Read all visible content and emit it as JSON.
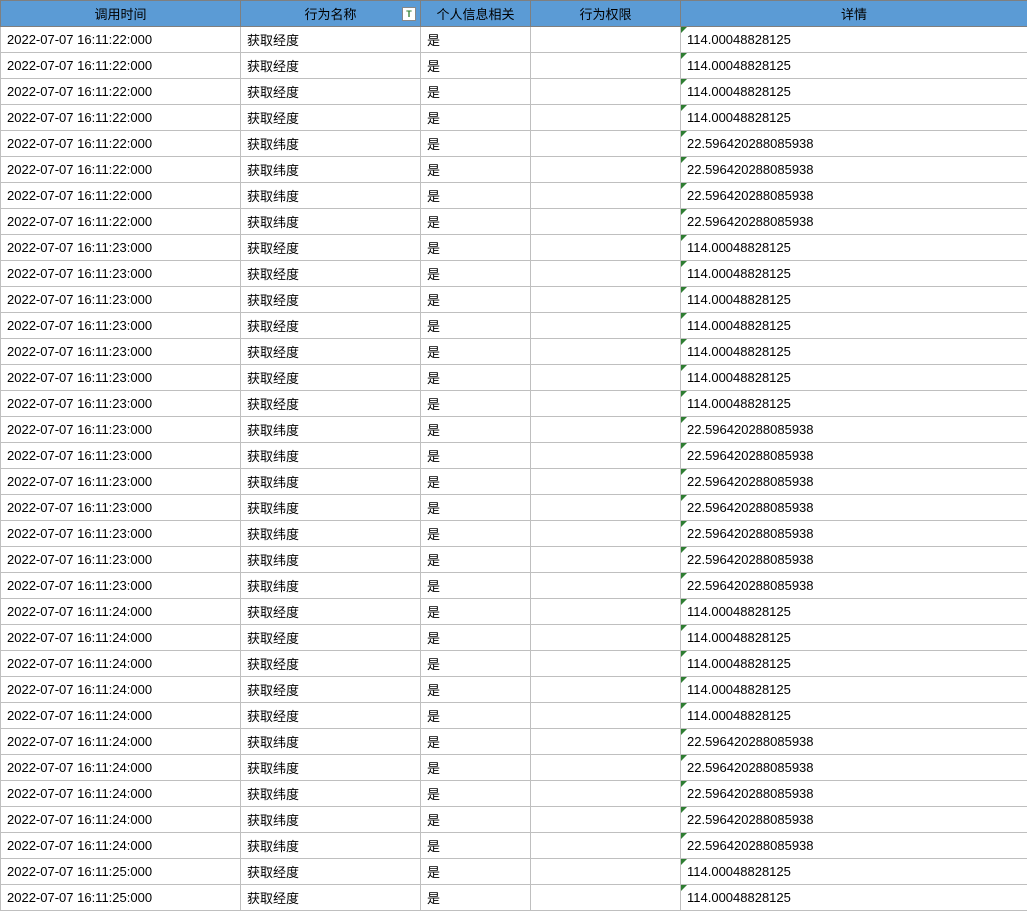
{
  "columns": [
    {
      "label": "调用时间",
      "filter": false
    },
    {
      "label": "行为名称",
      "filter": true
    },
    {
      "label": "个人信息相关",
      "filter": false
    },
    {
      "label": "行为权限",
      "filter": false
    },
    {
      "label": "详情",
      "filter": false
    }
  ],
  "filter_icon_text": "T",
  "rows": [
    {
      "time": "2022-07-07 16:11:22:000",
      "action": "获取经度",
      "personal": "是",
      "perm": "",
      "detail": "114.00048828125"
    },
    {
      "time": "2022-07-07 16:11:22:000",
      "action": "获取经度",
      "personal": "是",
      "perm": "",
      "detail": "114.00048828125"
    },
    {
      "time": "2022-07-07 16:11:22:000",
      "action": "获取经度",
      "personal": "是",
      "perm": "",
      "detail": "114.00048828125"
    },
    {
      "time": "2022-07-07 16:11:22:000",
      "action": "获取经度",
      "personal": "是",
      "perm": "",
      "detail": "114.00048828125"
    },
    {
      "time": "2022-07-07 16:11:22:000",
      "action": "获取纬度",
      "personal": "是",
      "perm": "",
      "detail": "22.596420288085938"
    },
    {
      "time": "2022-07-07 16:11:22:000",
      "action": "获取纬度",
      "personal": "是",
      "perm": "",
      "detail": "22.596420288085938"
    },
    {
      "time": "2022-07-07 16:11:22:000",
      "action": "获取纬度",
      "personal": "是",
      "perm": "",
      "detail": "22.596420288085938"
    },
    {
      "time": "2022-07-07 16:11:22:000",
      "action": "获取纬度",
      "personal": "是",
      "perm": "",
      "detail": "22.596420288085938"
    },
    {
      "time": "2022-07-07 16:11:23:000",
      "action": "获取经度",
      "personal": "是",
      "perm": "",
      "detail": "114.00048828125"
    },
    {
      "time": "2022-07-07 16:11:23:000",
      "action": "获取经度",
      "personal": "是",
      "perm": "",
      "detail": "114.00048828125"
    },
    {
      "time": "2022-07-07 16:11:23:000",
      "action": "获取经度",
      "personal": "是",
      "perm": "",
      "detail": "114.00048828125"
    },
    {
      "time": "2022-07-07 16:11:23:000",
      "action": "获取经度",
      "personal": "是",
      "perm": "",
      "detail": "114.00048828125"
    },
    {
      "time": "2022-07-07 16:11:23:000",
      "action": "获取经度",
      "personal": "是",
      "perm": "",
      "detail": "114.00048828125"
    },
    {
      "time": "2022-07-07 16:11:23:000",
      "action": "获取经度",
      "personal": "是",
      "perm": "",
      "detail": "114.00048828125"
    },
    {
      "time": "2022-07-07 16:11:23:000",
      "action": "获取经度",
      "personal": "是",
      "perm": "",
      "detail": "114.00048828125"
    },
    {
      "time": "2022-07-07 16:11:23:000",
      "action": "获取纬度",
      "personal": "是",
      "perm": "",
      "detail": "22.596420288085938"
    },
    {
      "time": "2022-07-07 16:11:23:000",
      "action": "获取纬度",
      "personal": "是",
      "perm": "",
      "detail": "22.596420288085938"
    },
    {
      "time": "2022-07-07 16:11:23:000",
      "action": "获取纬度",
      "personal": "是",
      "perm": "",
      "detail": "22.596420288085938"
    },
    {
      "time": "2022-07-07 16:11:23:000",
      "action": "获取纬度",
      "personal": "是",
      "perm": "",
      "detail": "22.596420288085938"
    },
    {
      "time": "2022-07-07 16:11:23:000",
      "action": "获取纬度",
      "personal": "是",
      "perm": "",
      "detail": "22.596420288085938"
    },
    {
      "time": "2022-07-07 16:11:23:000",
      "action": "获取纬度",
      "personal": "是",
      "perm": "",
      "detail": "22.596420288085938"
    },
    {
      "time": "2022-07-07 16:11:23:000",
      "action": "获取纬度",
      "personal": "是",
      "perm": "",
      "detail": "22.596420288085938"
    },
    {
      "time": "2022-07-07 16:11:24:000",
      "action": "获取经度",
      "personal": "是",
      "perm": "",
      "detail": "114.00048828125"
    },
    {
      "time": "2022-07-07 16:11:24:000",
      "action": "获取经度",
      "personal": "是",
      "perm": "",
      "detail": "114.00048828125"
    },
    {
      "time": "2022-07-07 16:11:24:000",
      "action": "获取经度",
      "personal": "是",
      "perm": "",
      "detail": "114.00048828125"
    },
    {
      "time": "2022-07-07 16:11:24:000",
      "action": "获取经度",
      "personal": "是",
      "perm": "",
      "detail": "114.00048828125"
    },
    {
      "time": "2022-07-07 16:11:24:000",
      "action": "获取经度",
      "personal": "是",
      "perm": "",
      "detail": "114.00048828125"
    },
    {
      "time": "2022-07-07 16:11:24:000",
      "action": "获取纬度",
      "personal": "是",
      "perm": "",
      "detail": "22.596420288085938"
    },
    {
      "time": "2022-07-07 16:11:24:000",
      "action": "获取纬度",
      "personal": "是",
      "perm": "",
      "detail": "22.596420288085938"
    },
    {
      "time": "2022-07-07 16:11:24:000",
      "action": "获取纬度",
      "personal": "是",
      "perm": "",
      "detail": "22.596420288085938"
    },
    {
      "time": "2022-07-07 16:11:24:000",
      "action": "获取纬度",
      "personal": "是",
      "perm": "",
      "detail": "22.596420288085938"
    },
    {
      "time": "2022-07-07 16:11:24:000",
      "action": "获取纬度",
      "personal": "是",
      "perm": "",
      "detail": "22.596420288085938"
    },
    {
      "time": "2022-07-07 16:11:25:000",
      "action": "获取经度",
      "personal": "是",
      "perm": "",
      "detail": "114.00048828125"
    },
    {
      "time": "2022-07-07 16:11:25:000",
      "action": "获取经度",
      "personal": "是",
      "perm": "",
      "detail": "114.00048828125"
    }
  ]
}
